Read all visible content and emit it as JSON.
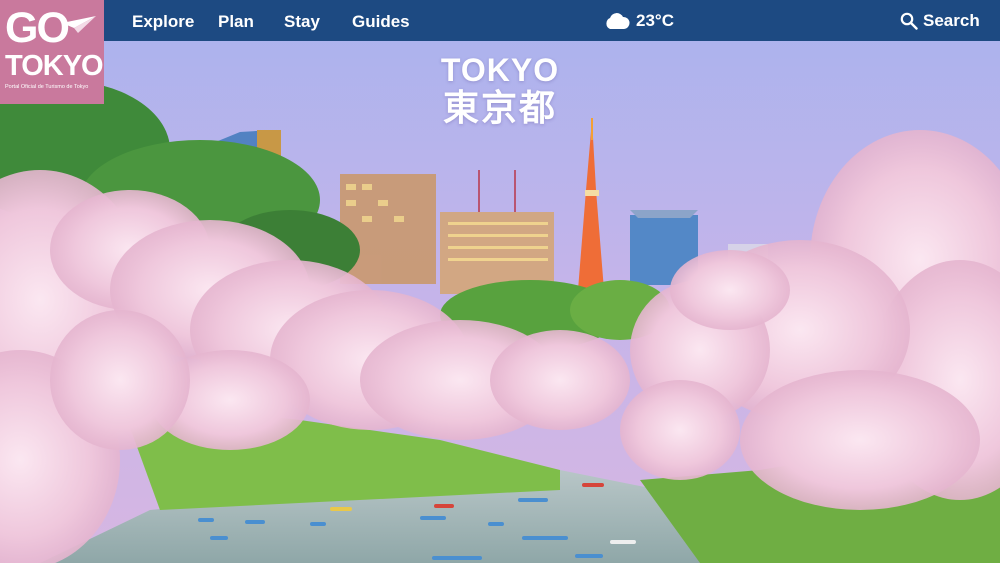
{
  "brand": {
    "logo_go": "GO",
    "logo_tokyo": "TOKYO",
    "tagline": "Portal Oficial de Turismo de Tokyo",
    "color": "#c9799d"
  },
  "nav": {
    "items": [
      {
        "label": "Explore"
      },
      {
        "label": "Plan"
      },
      {
        "label": "Stay"
      },
      {
        "label": "Guides"
      }
    ],
    "background": "#1d4a82"
  },
  "weather": {
    "icon": "cloud-icon",
    "temperature": "23°C"
  },
  "search": {
    "icon": "search-icon",
    "label": "Search"
  },
  "hero": {
    "title_en": "TOKYO",
    "title_jp": "東京都"
  }
}
